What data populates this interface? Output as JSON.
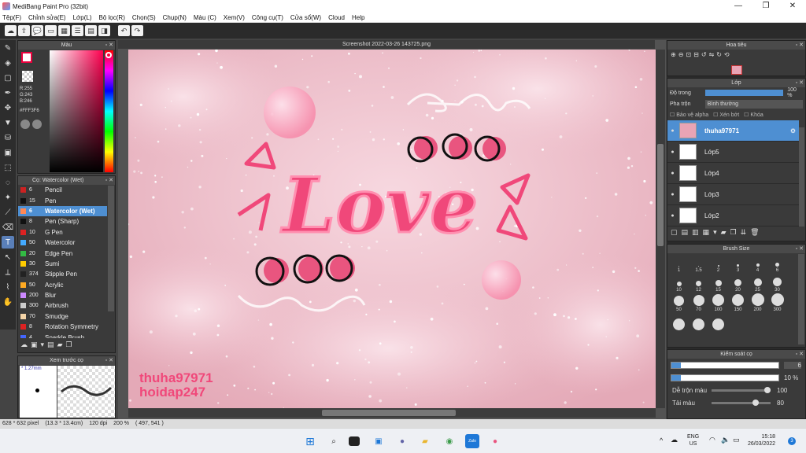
{
  "window": {
    "title": "MediBang Paint Pro (32bit)",
    "controls": [
      "—",
      "❐",
      "✕"
    ]
  },
  "menu": [
    "Tệp(F)",
    "Chỉnh sửa(E)",
    "Lớp(L)",
    "Bộ lọc(R)",
    "Chọn(S)",
    "Chụp(N)",
    "Màu (C)",
    "Xem(V)",
    "Công cụ(T)",
    "Cửa sổ(W)",
    "Cloud",
    "Help"
  ],
  "color_panel": {
    "title": "Màu",
    "r": "R:255",
    "g": "G:243",
    "b": "B:246",
    "hex": "#FFF3F6",
    "fg": "#ffffff",
    "bg": "#1c2cff",
    "accent": "#e8003c"
  },
  "brush_panel": {
    "title": "Cọ: Watercolor (Wet)",
    "items": [
      {
        "size": "6",
        "name": "Pencil",
        "color": "#cc2222"
      },
      {
        "size": "15",
        "name": "Pen",
        "color": "#111111"
      },
      {
        "size": "6",
        "name": "Watercolor (Wet)",
        "color": "#ff8855",
        "selected": true
      },
      {
        "size": "8",
        "name": "Pen (Sharp)",
        "color": "#111111"
      },
      {
        "size": "10",
        "name": "G Pen",
        "color": "#dd2222"
      },
      {
        "size": "50",
        "name": "Watercolor",
        "color": "#44aaff"
      },
      {
        "size": "20",
        "name": "Edge Pen",
        "color": "#33bb44"
      },
      {
        "size": "30",
        "name": "Sumi",
        "color": "#ffcc00"
      },
      {
        "size": "374",
        "name": "Stipple Pen",
        "color": "#222222"
      },
      {
        "size": "50",
        "name": "Acrylic",
        "color": "#ffaa22"
      },
      {
        "size": "200",
        "name": "Blur",
        "color": "#cc88ff"
      },
      {
        "size": "300",
        "name": "Airbrush",
        "color": "#cccccc"
      },
      {
        "size": "70",
        "name": "Smudge",
        "color": "#f5d5a8"
      },
      {
        "size": "8",
        "name": "Rotation Symmetry",
        "color": "#dd2222"
      },
      {
        "size": "4",
        "name": "Sparkle Brush",
        "color": "#4466ff"
      }
    ]
  },
  "preview_panel": {
    "title": "Xem trước cọ",
    "size": "* 1.27mm"
  },
  "document": {
    "title": "Screenshot 2022-03-26 143725.png"
  },
  "artwork": {
    "word": "Love",
    "signature_1": "thuha97971",
    "signature_2": "hoidap247"
  },
  "navigator": {
    "title": "Hoa tiêu"
  },
  "layer_panel": {
    "title": "Lớp",
    "opacity_label": "Độ trong",
    "opacity_value": "100 %",
    "opacity_level": 1.0,
    "blend_label": "Pha trộn",
    "blend_value": "Bình thường",
    "protect_alpha": "Bảo vệ alpha",
    "clipping": "Xén bớt",
    "lock": "Khóa",
    "layers": [
      {
        "name": "thuha97971",
        "selected": true
      },
      {
        "name": "Lớp5"
      },
      {
        "name": "Lớp4"
      },
      {
        "name": "Lớp3"
      },
      {
        "name": "Lớp2"
      }
    ]
  },
  "brush_size_panel": {
    "title": "Brush Size",
    "sizes": [
      "1",
      "1.5",
      "2",
      "3",
      "4",
      "6",
      "10",
      "12",
      "15",
      "20",
      "25",
      "30",
      "50",
      "70",
      "100",
      "150",
      "200",
      "300",
      "",
      "",
      ""
    ]
  },
  "control_panel": {
    "title": "Kiểm soát cọ",
    "size_value": "6",
    "opacity_value": "10 %",
    "mix_label": "Dễ trộn màu",
    "mix_value": "100",
    "mix_level": 1.0,
    "color_amount_label": "Tải màu",
    "color_amount_value": "80",
    "color_amount_level": 0.8
  },
  "status": {
    "dims": "628 * 632 pixel",
    "physical": "(13.3 * 13.4cm)",
    "dpi": "120 dpi",
    "zoom": "200 %",
    "coords": "( 497, 541 )"
  },
  "taskbar": {
    "lang1": "ENG",
    "lang2": "US",
    "time": "15:18",
    "date": "26/03/2022",
    "badge": "3",
    "zalo": "Zalo"
  }
}
